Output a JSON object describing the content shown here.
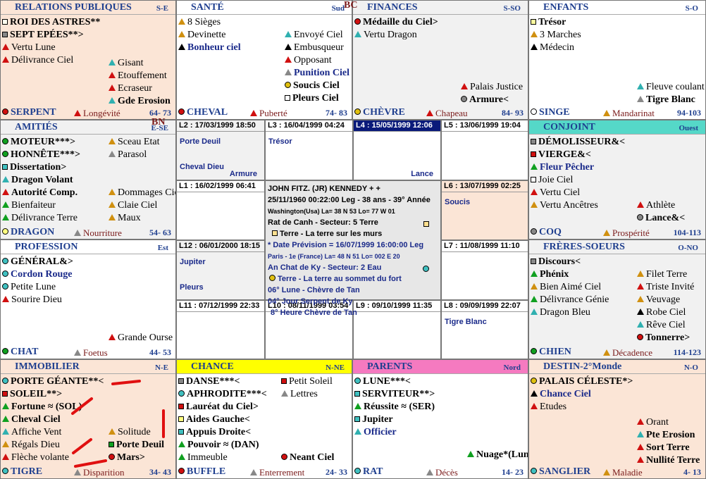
{
  "colors": {
    "peach": "#fbe5d6",
    "grey": "#f1f1f1",
    "teal": "#55d8c8",
    "yellow": "#ffff00",
    "pink": "#f57ac0",
    "navy": "#0a1a7a",
    "red": "#d01010",
    "green": "#10a020",
    "blue": "#3030c0",
    "orange": "#d09010"
  },
  "marks": {
    "bc": "BC",
    "bn": "BN"
  },
  "palaces": [
    {
      "id": "relations",
      "name": "RELATIONS PUBLIQUES",
      "dir": "S-E",
      "foot": {
        "main": "SERPENT",
        "sub": "Longévité",
        "range": "64- 73"
      },
      "colL": [
        {
          "t": "ROI DES ASTRES**",
          "sym": "sq",
          "c": "#fffff0",
          "b": true
        },
        {
          "t": "SEPT EPÉES**>",
          "sym": "sq",
          "c": "#888888",
          "b": true
        },
        {
          "t": "Vertu Lune",
          "sym": "tri",
          "c": "#d01010"
        },
        {
          "t": "Délivrance Ciel",
          "sym": "tri",
          "c": "#d01010"
        }
      ],
      "colR": [
        {
          "t": "Gisant",
          "sym": "tri",
          "c": "#30b0b0"
        },
        {
          "t": "Etouffement",
          "sym": "tri",
          "c": "#d01010"
        },
        {
          "t": "Ecraseur",
          "sym": "tri",
          "c": "#d01010"
        },
        {
          "t": "Gde Erosion",
          "sym": "tri",
          "c": "#30b0b0",
          "b": true
        }
      ]
    },
    {
      "id": "sante",
      "name": "SANTÉ",
      "dir": "Sud",
      "foot": {
        "main": "CHEVAL",
        "sub": "Puberté",
        "range": "74- 83"
      },
      "colL": [
        {
          "t": "8 Sièges",
          "sym": "tri",
          "c": "#d09010"
        },
        {
          "t": "Devinette",
          "sym": "tri",
          "c": "#d09010"
        },
        {
          "t": "Bonheur ciel",
          "sym": "tri",
          "c": "#000000",
          "b": true,
          "blue": true
        }
      ],
      "colR": [
        {
          "t": "Envoyé Ciel",
          "sym": "tri",
          "c": "#30b0b0"
        },
        {
          "t": "Embusqueur",
          "sym": "tri",
          "c": "#000000"
        },
        {
          "t": "Opposant",
          "sym": "tri",
          "c": "#d01010"
        },
        {
          "t": "Punition Ciel",
          "sym": "tri",
          "c": "#888888",
          "b": true,
          "blue": true
        },
        {
          "t": "Soucis Ciel",
          "sym": "ci",
          "c": "#e0c010",
          "b": true
        },
        {
          "t": "Pleurs Ciel",
          "sym": "sq",
          "c": "#ffffff",
          "b": true
        }
      ]
    },
    {
      "id": "finances",
      "name": "FINANCES",
      "dir": "S-SO",
      "foot": {
        "main": "CHÈVRE",
        "sub": "Chapeau",
        "range": "84- 93"
      },
      "colL": [
        {
          "t": "Médaille du Ciel>",
          "sym": "ci",
          "c": "#d01010",
          "b": true
        },
        {
          "t": "Vertu Dragon",
          "sym": "tri",
          "c": "#30b0b0"
        }
      ],
      "colR": [
        {
          "t": "Palais Justice",
          "sym": "tri",
          "c": "#d01010"
        },
        {
          "t": "Armure<",
          "sym": "ci",
          "c": "#888888",
          "b": true
        }
      ]
    },
    {
      "id": "enfants",
      "name": "ENFANTS",
      "dir": "S-O",
      "foot": {
        "main": "SINGE",
        "sub": "Mandarinat",
        "range": "94-103"
      },
      "colL": [
        {
          "t": "Trésor",
          "sym": "sq",
          "c": "#ffffa0",
          "b": true
        },
        {
          "t": "3 Marches",
          "sym": "tri",
          "c": "#d09010"
        },
        {
          "t": "Médecin",
          "sym": "tri",
          "c": "#000000"
        }
      ],
      "colR": [
        {
          "t": "Fleuve coulant",
          "sym": "tri",
          "c": "#30b0b0"
        },
        {
          "t": "Tigre Blanc",
          "sym": "tri",
          "c": "#888888",
          "b": true
        }
      ]
    },
    {
      "id": "amities",
      "name": "AMITIÉS",
      "dir": "E-SE",
      "foot": {
        "main": "DRAGON",
        "sub": "Nourriture",
        "range": "54- 63"
      },
      "colL": [
        {
          "t": "MOTEUR***>",
          "sym": "ci",
          "c": "#10a020",
          "b": true
        },
        {
          "t": "HONNÊTE***>",
          "sym": "ci",
          "c": "#10a020",
          "b": true
        },
        {
          "t": "Dissertation>",
          "sym": "sq",
          "c": "#40c0c0",
          "b": true
        },
        {
          "t": "Dragon Volant",
          "sym": "tri",
          "c": "#30b0b0",
          "b": true
        },
        {
          "t": "Autorité Comp.",
          "sym": "tri",
          "c": "#d01010",
          "b": true
        },
        {
          "t": "Bienfaiteur",
          "sym": "tri",
          "c": "#10a020"
        },
        {
          "t": "Délivrance Terre",
          "sym": "tri",
          "c": "#10a020"
        }
      ],
      "colR": [
        {
          "t": "Sceau Etat",
          "sym": "tri",
          "c": "#d09010"
        },
        {
          "t": "Parasol",
          "sym": "tri",
          "c": "#888888"
        },
        {
          "t": "",
          "sym": ""
        },
        {
          "t": "",
          "sym": ""
        },
        {
          "t": "Dommages Ciel",
          "sym": "tri",
          "c": "#d09010"
        },
        {
          "t": "Claie Ciel",
          "sym": "tri",
          "c": "#d09010"
        },
        {
          "t": "Maux",
          "sym": "tri",
          "c": "#d09010"
        }
      ]
    },
    {
      "id": "conjoint",
      "name": "CONJOINT",
      "dir": "Ouest",
      "foot": {
        "main": "COQ",
        "sub": "Prospérité",
        "range": "104-113"
      },
      "colL": [
        {
          "t": "DÉMOLISSEUR&<",
          "sym": "sq",
          "c": "#888888",
          "b": true
        },
        {
          "t": "VIERGE&<",
          "sym": "sq",
          "c": "#d01010",
          "b": true
        },
        {
          "t": "Fleur Pêcher",
          "sym": "tri",
          "c": "#10a020",
          "b": true,
          "blue": true
        },
        {
          "t": "Joie Ciel",
          "sym": "sq",
          "c": "#ffffff"
        },
        {
          "t": "Vertu Ciel",
          "sym": "tri",
          "c": "#d01010"
        },
        {
          "t": "Vertu Ancêtres",
          "sym": "tri",
          "c": "#d09010"
        }
      ],
      "colR": [
        {
          "t": "",
          "sym": ""
        },
        {
          "t": "",
          "sym": ""
        },
        {
          "t": "",
          "sym": ""
        },
        {
          "t": "",
          "sym": ""
        },
        {
          "t": "",
          "sym": ""
        },
        {
          "t": "Athlète",
          "sym": "tri",
          "c": "#d01010"
        },
        {
          "t": "Lance&<",
          "sym": "ci",
          "c": "#888888",
          "b": true
        }
      ]
    },
    {
      "id": "profession",
      "name": "PROFESSION",
      "dir": "Est",
      "foot": {
        "main": "CHAT",
        "sub": "Foetus",
        "range": "44- 53"
      },
      "colL": [
        {
          "t": "GÉNÉRAL&>",
          "sym": "ci",
          "c": "#40c0c0",
          "b": true
        },
        {
          "t": "Cordon Rouge",
          "sym": "ci",
          "c": "#40c0c0",
          "b": true,
          "blue": true
        },
        {
          "t": "Petite Lune",
          "sym": "ci",
          "c": "#40c0c0"
        },
        {
          "t": "Sourire Dieu",
          "sym": "tri",
          "c": "#d01010"
        }
      ],
      "colR": [
        {
          "t": "Grande Ourse",
          "sym": "tri",
          "c": "#d01010"
        }
      ]
    },
    {
      "id": "freres",
      "name": "FRÈRES-SOEURS",
      "dir": "O-NO",
      "foot": {
        "main": "CHIEN",
        "sub": "Décadence",
        "range": "114-123"
      },
      "colL": [
        {
          "t": "Discours<",
          "sym": "sq",
          "c": "#888888",
          "b": true
        },
        {
          "t": "Phénix",
          "sym": "tri",
          "c": "#10a020",
          "b": true
        },
        {
          "t": "Bien Aimé Ciel",
          "sym": "tri",
          "c": "#d09010"
        },
        {
          "t": "Délivrance Génie",
          "sym": "tri",
          "c": "#10a020"
        },
        {
          "t": "Dragon Bleu",
          "sym": "tri",
          "c": "#30b0b0"
        }
      ],
      "colR": [
        {
          "t": "",
          "sym": ""
        },
        {
          "t": "Filet Terre",
          "sym": "tri",
          "c": "#d09010"
        },
        {
          "t": "Triste Invité",
          "sym": "tri",
          "c": "#d01010"
        },
        {
          "t": "Veuvage",
          "sym": "tri",
          "c": "#d09010"
        },
        {
          "t": "Robe Ciel",
          "sym": "tri",
          "c": "#000000"
        },
        {
          "t": "Rêve Ciel",
          "sym": "tri",
          "c": "#30b0b0"
        },
        {
          "t": "Tonnerre>",
          "sym": "ci",
          "c": "#d01010",
          "b": true
        }
      ]
    },
    {
      "id": "immobilier",
      "name": "IMMOBILIER",
      "dir": "N-E",
      "foot": {
        "main": "TIGRE",
        "sub": "Disparition",
        "range": "34- 43"
      },
      "colL": [
        {
          "t": "PORTE GÉANTE**<",
          "sym": "ci",
          "c": "#40c0c0",
          "b": true
        },
        {
          "t": "SOLEIL**>",
          "sym": "sq",
          "c": "#d01010",
          "b": true
        },
        {
          "t": "Fortune ≈ (SOL)",
          "sym": "tri",
          "c": "#10a020",
          "b": true
        },
        {
          "t": "Cheval Ciel",
          "sym": "tri",
          "c": "#10a020",
          "b": true
        },
        {
          "t": "Affiche Vent",
          "sym": "tri",
          "c": "#30b0b0"
        },
        {
          "t": "Régals Dieu",
          "sym": "tri",
          "c": "#d09010"
        },
        {
          "t": "Flèche volante",
          "sym": "tri",
          "c": "#d01010"
        }
      ],
      "colR": [
        {
          "t": "",
          "sym": ""
        },
        {
          "t": "",
          "sym": ""
        },
        {
          "t": "",
          "sym": ""
        },
        {
          "t": "",
          "sym": ""
        },
        {
          "t": "Solitude",
          "sym": "tri",
          "c": "#d09010"
        },
        {
          "t": "Porte Deuil",
          "sym": "sq",
          "c": "#10a020",
          "b": true
        },
        {
          "t": "Mars>",
          "sym": "ci",
          "c": "#d01010",
          "b": true
        }
      ]
    },
    {
      "id": "chance",
      "name": "CHANCE",
      "dir": "N-NE",
      "foot": {
        "main": "BUFFLE",
        "sub": "Enterrement",
        "range": "24- 33"
      },
      "colL": [
        {
          "t": "DANSE***<",
          "sym": "sq",
          "c": "#888888",
          "b": true
        },
        {
          "t": "APHRODITE***<",
          "sym": "ci",
          "c": "#40c0c0",
          "b": true
        },
        {
          "t": "Lauréat du Ciel>",
          "sym": "sq",
          "c": "#d01010",
          "b": true
        },
        {
          "t": "Aides Gauche<",
          "sym": "sq",
          "c": "#ffff80",
          "b": true
        },
        {
          "t": "Appuis Droite<",
          "sym": "sq",
          "c": "#40c0c0",
          "b": true
        },
        {
          "t": "Pouvoir ≈ (DAN)",
          "sym": "tri",
          "c": "#10a020",
          "b": true
        },
        {
          "t": "Immeuble",
          "sym": "tri",
          "c": "#10a020"
        }
      ],
      "colR": [
        {
          "t": "Petit Soleil",
          "sym": "sq",
          "c": "#d01010"
        },
        {
          "t": "Lettres",
          "sym": "tri",
          "c": "#888888"
        },
        {
          "t": "",
          "sym": ""
        },
        {
          "t": "",
          "sym": ""
        },
        {
          "t": "",
          "sym": ""
        },
        {
          "t": "",
          "sym": ""
        },
        {
          "t": "Neant Ciel",
          "sym": "ci",
          "c": "#d01010",
          "b": true
        }
      ]
    },
    {
      "id": "parents",
      "name": "PARENTS",
      "dir": "Nord",
      "foot": {
        "main": "RAT",
        "sub": "Décès",
        "range": "14- 23"
      },
      "colL": [
        {
          "t": "LUNE***<",
          "sym": "ci",
          "c": "#40c0c0",
          "b": true
        },
        {
          "t": "SERVITEUR**>",
          "sym": "sq",
          "c": "#40c0c0",
          "b": true
        },
        {
          "t": "Réussite ≈ (SER)",
          "sym": "tri",
          "c": "#10a020",
          "b": true
        },
        {
          "t": "Jupiter",
          "sym": "sq",
          "c": "#40c0c0",
          "b": true
        },
        {
          "t": "Officier",
          "sym": "tri",
          "c": "#30b0b0",
          "b": true,
          "blue": true
        }
      ],
      "colR": [
        {
          "t": "Nuage*(Lune)",
          "sym": "tri",
          "c": "#10a020",
          "b": true
        }
      ]
    },
    {
      "id": "destin",
      "name": "DESTIN-2°Monde",
      "dir": "N-O",
      "foot": {
        "main": "SANGLIER",
        "sub": "Maladie",
        "range": "4- 13"
      },
      "colL": [
        {
          "t": "PALAIS CÉLESTE*>",
          "sym": "ci",
          "c": "#e0c010",
          "b": true
        },
        {
          "t": "Chance Ciel",
          "sym": "tri",
          "c": "#000000",
          "b": true,
          "blue": true
        },
        {
          "t": "Etudes",
          "sym": "tri",
          "c": "#d01010"
        }
      ],
      "colR": [
        {
          "t": "Orant",
          "sym": "tri",
          "c": "#d01010"
        },
        {
          "t": "Pte Erosion",
          "sym": "tri",
          "c": "#30b0b0",
          "b": true
        },
        {
          "t": "Sort Terre",
          "sym": "tri",
          "c": "#d01010",
          "b": true
        },
        {
          "t": "Nullité Terre",
          "sym": "tri",
          "c": "#d01010",
          "b": true
        }
      ]
    }
  ],
  "cells": [
    {
      "id": "L2",
      "h": "L2 : 17/03/1999 18:50",
      "a": "Porte Deuil",
      "b": "Cheval Dieu",
      "c": "Armure"
    },
    {
      "id": "L3",
      "h": "L3 : 16/04/1999 04:24",
      "a": "Trésor",
      "b": "",
      "c": ""
    },
    {
      "id": "L4",
      "h": "L4 : 15/05/1999 12:06",
      "a": "",
      "b": "",
      "c": "Lance"
    },
    {
      "id": "L5",
      "h": "L5 : 13/06/1999 19:04",
      "a": "",
      "b": "",
      "c": ""
    },
    {
      "id": "L1",
      "h": "L1 : 16/02/1999 06:41",
      "a": "",
      "b": "",
      "c": ""
    },
    {
      "id": "L6",
      "h": "L6 : 13/07/1999 02:25",
      "a": "Soucis",
      "b": "",
      "c": ""
    },
    {
      "id": "L12",
      "h": "L12 : 06/01/2000 18:15",
      "a": "Jupiter",
      "b": "Pleurs",
      "c": ""
    },
    {
      "id": "L7",
      "h": "L7 : 11/08/1999 11:10",
      "a": "",
      "b": "",
      "c": ""
    },
    {
      "id": "L11",
      "h": "L11 : 07/12/1999 22:33",
      "a": "",
      "b": "",
      "c": ""
    },
    {
      "id": "L10",
      "h": "L10 : 08/11/1999 03:54",
      "a": "",
      "b": "",
      "c": ""
    },
    {
      "id": "L9",
      "h": "L9 : 09/10/1999 11:35",
      "a": "",
      "b": "",
      "c": ""
    },
    {
      "id": "L8",
      "h": "L8 : 09/09/1999 22:07",
      "a": "Tigre Blanc",
      "b": "",
      "c": ""
    }
  ],
  "center": {
    "lines": [
      "JOHN FITZ. (JR) KENNEDY  + +",
      "25/11/1960 00:22:00 Leg - 38 ans - 39° Année",
      "Washington(Usa) La= 38 N 53  Lo= 77 W 01",
      "Rat de Canh  -   Secteur:  5 Terre",
      "Terre  - La terre sur les murs",
      "* Date Prévision  =  16/07/1999 16:00:00 Leg",
      "Paris  - 1e (France) La= 48 N 51  Lo= 002 E 20",
      "An Chat de Ky  -  Secteur:  2 Eau",
      "Terre  - La terre au sommet du fort",
      "06° Lune - Chèvre de Tan",
      "04° Jour Serpent de Ky",
      "8° Heure Chèvre de Tan"
    ]
  }
}
